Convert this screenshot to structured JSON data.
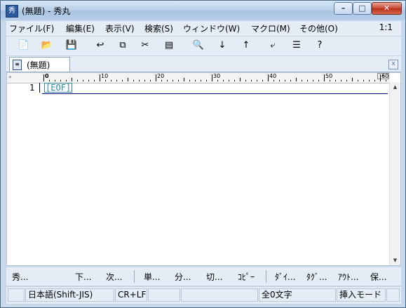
{
  "window": {
    "title": "(無題) - 秀丸",
    "app_icon": "hidemaru-app-icon",
    "app_icon_char": "秀",
    "controls": {
      "minimize": "–",
      "maximize": "□",
      "close": "✕"
    }
  },
  "menubar": {
    "items": [
      "ファイル(F)",
      "編集(E)",
      "表示(V)",
      "検索(S)",
      "ウィンドウ(W)",
      "マクロ(M)",
      "その他(O)"
    ],
    "cursor_position": "1:1"
  },
  "toolbar": {
    "icons": [
      {
        "name": "new-file-icon",
        "glyph": "📄"
      },
      {
        "name": "open-folder-icon",
        "glyph": "📂"
      },
      {
        "name": "save-icon",
        "glyph": "💾"
      },
      {
        "name": "undo-icon",
        "glyph": "↩"
      },
      {
        "name": "copy-icon",
        "glyph": "⧉"
      },
      {
        "name": "cut-icon",
        "glyph": "✂"
      },
      {
        "name": "paste-icon",
        "glyph": "▤"
      },
      {
        "name": "find-icon",
        "glyph": "🔍"
      },
      {
        "name": "find-down-icon",
        "glyph": "↓"
      },
      {
        "name": "find-up-icon",
        "glyph": "↑"
      },
      {
        "name": "tag-jump-icon",
        "glyph": "⤶"
      },
      {
        "name": "split-window-icon",
        "glyph": "☰"
      },
      {
        "name": "help-icon",
        "glyph": "?"
      }
    ]
  },
  "tab": {
    "label": "(無題)",
    "icon": "document-icon",
    "close_glyph": "x"
  },
  "ruler": {
    "labels": [
      "0",
      "10",
      "20",
      "30",
      "40",
      "50",
      "60"
    ],
    "scroll_glyph": "«"
  },
  "editor": {
    "line_number": "1",
    "eof_marker": "[EOF]"
  },
  "function_keys": [
    "秀...",
    "下...",
    "次...",
    "単...",
    "分...",
    "切...",
    "ｺﾋﾟｰ",
    "ﾀﾞｲ...",
    "ﾀｸﾞ...",
    "ｱｳﾄ...",
    "保..."
  ],
  "statusbar": {
    "encoding": "日本語(Shift-JIS)",
    "line_ending": "CR+LF",
    "char_count": "全0文字",
    "mode": "挿入モード"
  }
}
